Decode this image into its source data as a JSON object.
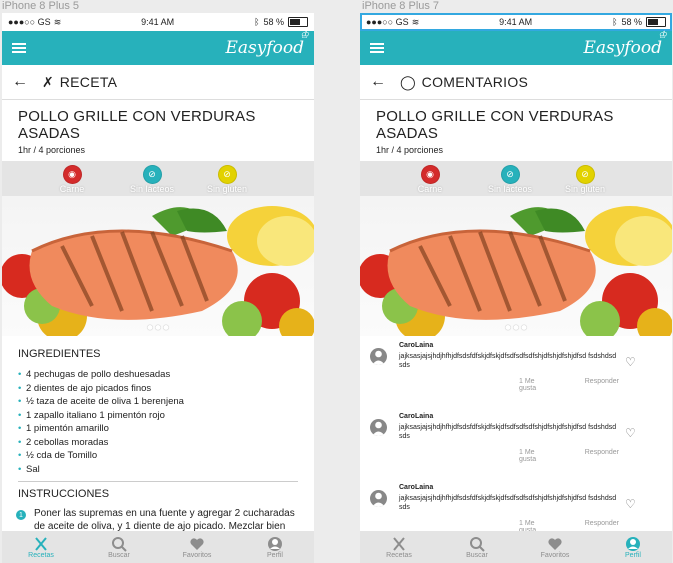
{
  "colors": {
    "accent": "#27b1bb",
    "carne": "#d42b2b",
    "lacteos": "#27b1bb",
    "gluten": "#e2d200"
  },
  "frames": [
    "iPhone 8 Plus 5",
    "iPhone 8 Plus 7"
  ],
  "status": {
    "carrier": "●●●○○ GS",
    "wifi_icon": "wifi-icon",
    "time": "9:41 AM",
    "bluetooth_icon": "bluetooth-icon",
    "battery": "58 %"
  },
  "brand": "Easyfood",
  "recipe": {
    "title": "POLLO GRILLE CON VERDURAS ASADAS",
    "meta": "1hr / 4 porciones",
    "tags": [
      {
        "label": "Carne",
        "icon": "meat-icon"
      },
      {
        "label": "Sin lácteos",
        "icon": "no-dairy-icon"
      },
      {
        "label": "Sin gluten",
        "icon": "no-gluten-icon"
      }
    ]
  },
  "screen1": {
    "subtitle": "RECETA",
    "ingredients_title": "INGREDIENTES",
    "ingredients": [
      "4 pechugas de pollo deshuesadas",
      "2 dientes de ajo picados finos",
      "½ taza de aceite de oliva 1 berenjena",
      "1 zapallo italiano 1 pimentón rojo",
      "1 pimentón amarillo",
      "2 cebollas moradas",
      "½ cda de Tomillo",
      "Sal"
    ],
    "instructions_title": "INSTRUCCIONES",
    "step_number": "1",
    "step_text": "Poner las supremas en una fuente y agregar 2 cucharadas de aceite de oliva, y 1 diente de ajo picado. Mezclar bien con el pollo. Reservar."
  },
  "screen2": {
    "subtitle": "COMENTARIOS",
    "comments": [
      {
        "user": "CaroLaina",
        "text": "jajksasjajsjhdjhfhjdfsdsfdfskjdfskjdfsdfsdfsdfshjdfshjdfshjdfsd fsdshdsdsds",
        "like": "1 Me gusta",
        "reply": "Responder"
      },
      {
        "user": "CaroLaina",
        "text": "jajksasjajsjhdjhfhjdfsdsfdfskjdfskjdfsdfsdfsdfshjdfshjdfshjdfsd fsdshdsdsds",
        "like": "1 Me gusta",
        "reply": "Responder"
      },
      {
        "user": "CaroLaina",
        "text": "jajksasjajsjhdjhfhjdfsdsfdfskjdfskjdfsdfsdfsdfshjdfshjdfshjdfsd fsdshdsdsds",
        "like": "1 Me gusta",
        "reply": "Responder"
      }
    ]
  },
  "tabs": [
    "Recetas",
    "Buscar",
    "Favoritos",
    "Perfil"
  ]
}
